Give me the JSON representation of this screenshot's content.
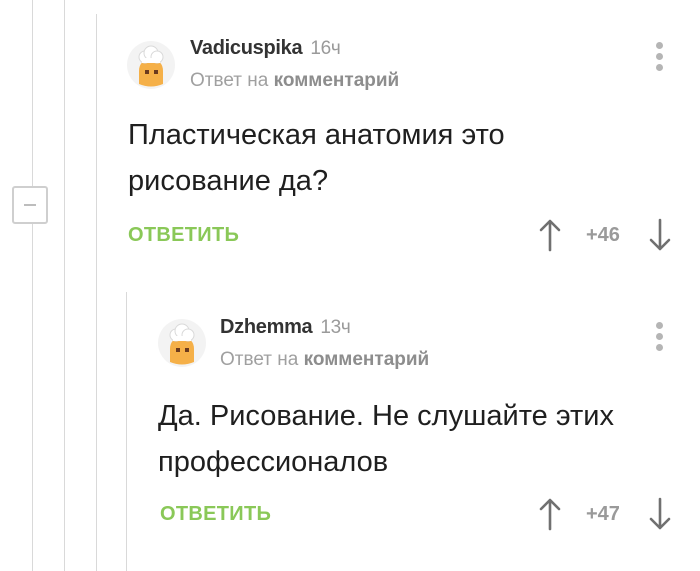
{
  "comments": [
    {
      "author": "Vadicuspika",
      "time": "16ч",
      "reply_prefix": "Ответ на",
      "reply_target": "комментарий",
      "text_lines": [
        "Пластическая анатомия это",
        "рисование да?"
      ],
      "reply_label": "ОТВЕТИТЬ",
      "rating": "+46"
    },
    {
      "author": "Dzhemma",
      "time": "13ч",
      "reply_prefix": "Ответ на",
      "reply_target": "комментарий",
      "text_lines": [
        "Да. Рисование. Не слушайте этих",
        "профессионалов"
      ],
      "reply_label": "ОТВЕТИТЬ",
      "rating": "+47"
    }
  ],
  "icons": {
    "avatar": "chef-avatar-icon",
    "more": "more-vertical-icon",
    "upvote": "arrow-up-icon",
    "downvote": "arrow-down-icon",
    "collapse": "minus-icon"
  },
  "colors": {
    "reply_accent": "#8ac858",
    "muted": "#9a9a9a",
    "avatar_face": "#f5b048",
    "tree_line": "#d9d9d9"
  }
}
